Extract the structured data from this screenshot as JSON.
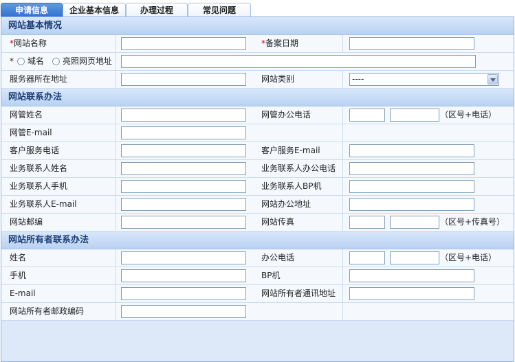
{
  "tabs": [
    "申请信息",
    "企业基本信息",
    "办理过程",
    "常见问题"
  ],
  "sections": {
    "basic": "网站基本情况",
    "contact": "网站联系办法",
    "owner": "网站所有者联系办法"
  },
  "basic": {
    "site_name_label": "网站名称",
    "record_date_label": "备案日期",
    "domain_label": "域名",
    "photo_addr_label": "亮照网页地址",
    "server_addr_label": "服务器所在地址",
    "site_type_label": "网站类别",
    "site_type_value": "----",
    "required_mark": "*"
  },
  "contact": {
    "admin_name": "网管姓名",
    "admin_phone": "网管办公电话",
    "admin_phone_hint": "（区号+电话）",
    "admin_email": "网管E-mail",
    "cs_phone": "客户服务电话",
    "cs_email": "客户服务E-mail",
    "biz_name": "业务联系人姓名",
    "biz_office_phone": "业务联系人办公电话",
    "biz_mobile": "业务联系人手机",
    "biz_bp": "业务联系人BP机",
    "biz_email": "业务联系人E-mail",
    "office_addr": "网站办公地址",
    "postcode": "网站邮编",
    "fax": "网站传真",
    "fax_hint": "（区号+传真号）"
  },
  "owner": {
    "name": "姓名",
    "office_phone": "办公电话",
    "phone_hint": "（区号+电话）",
    "mobile": "手机",
    "bp": "BP机",
    "email": "E-mail",
    "mail_addr": "网站所有者通讯地址",
    "postcode": "网站所有者邮政编码"
  }
}
